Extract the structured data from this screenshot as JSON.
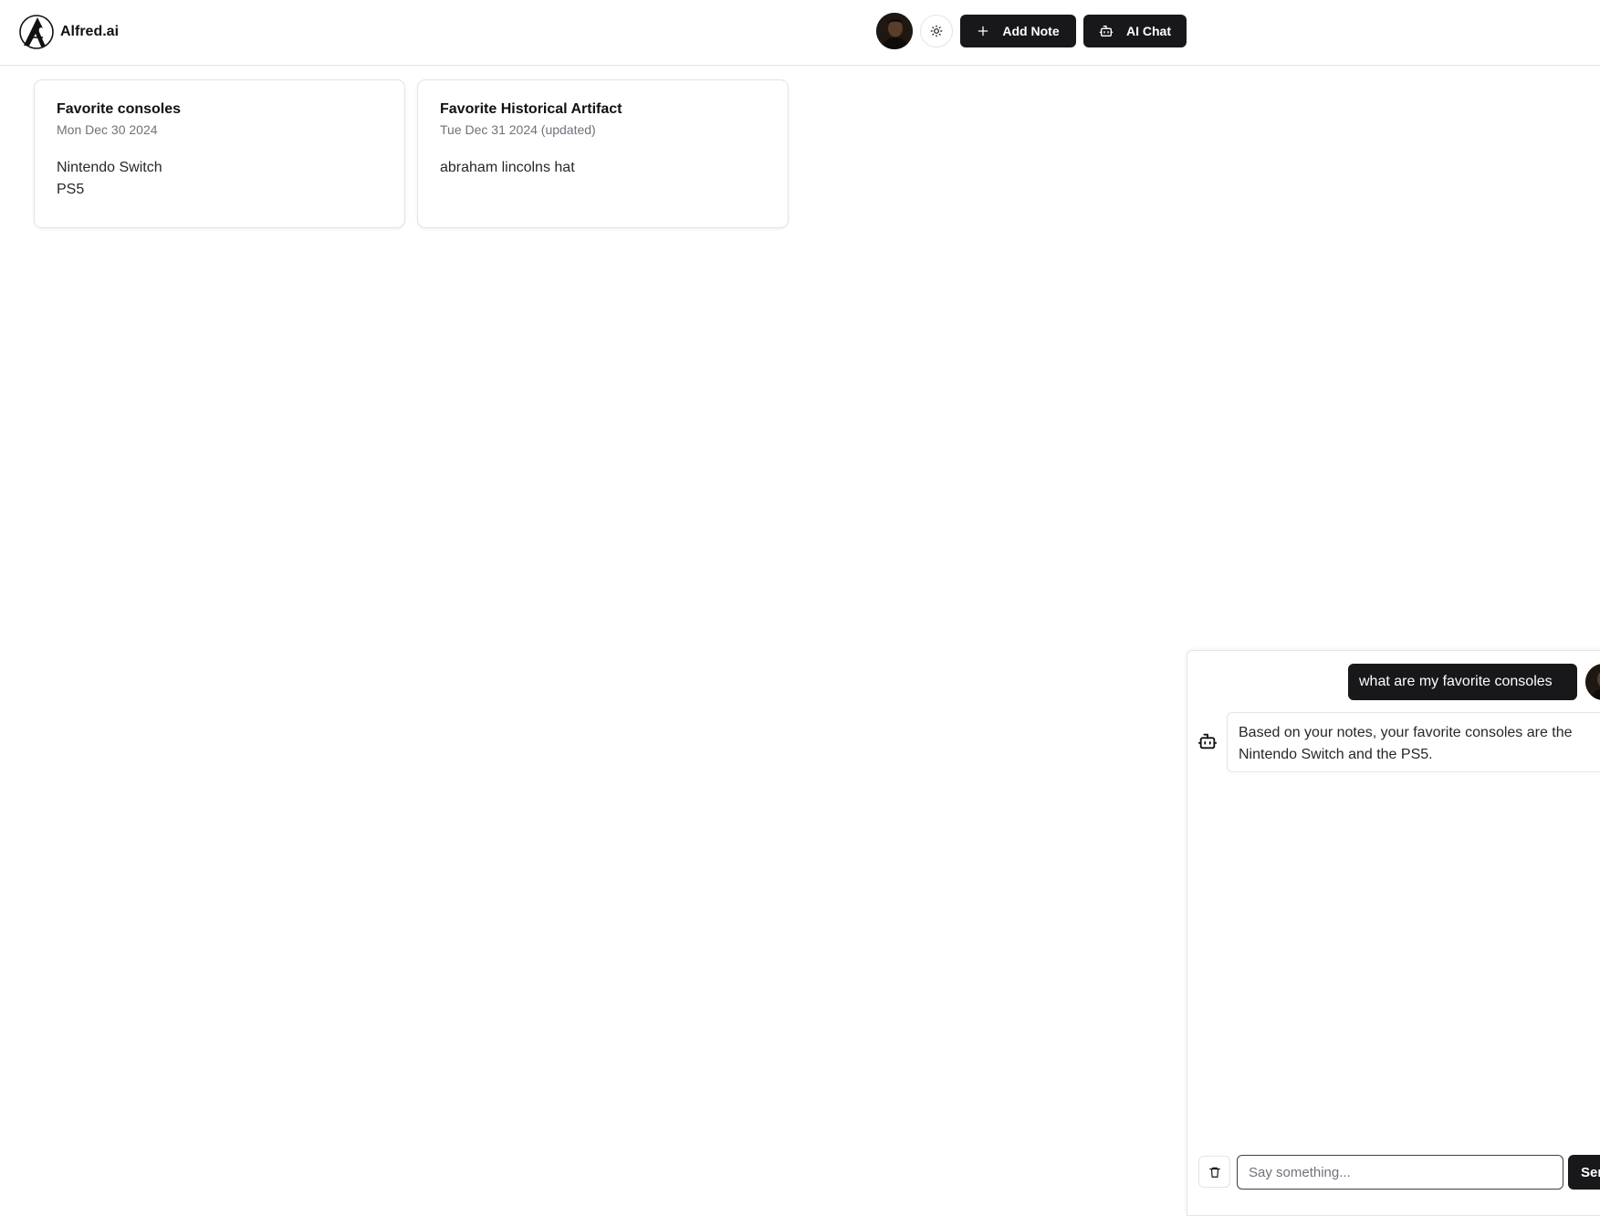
{
  "header": {
    "brand_name": "Alfred.ai",
    "logo_icon": "alfred-a-logo-icon",
    "theme_toggle_icon": "sun-icon",
    "add_note_label": "Add Note",
    "add_note_icon": "plus-icon",
    "ai_chat_label": "AI Chat",
    "ai_chat_icon": "bot-icon"
  },
  "notes": [
    {
      "title": "Favorite consoles",
      "date": "Mon Dec 30 2024",
      "body": "Nintendo Switch\nPS5"
    },
    {
      "title": "Favorite Historical Artifact",
      "date": "Tue Dec 31 2024 (updated)",
      "body": "abraham lincolns hat"
    }
  ],
  "chat": {
    "messages": [
      {
        "role": "user",
        "text": "what are my favorite consoles"
      },
      {
        "role": "assistant",
        "text": "Based on your notes, your favorite consoles are the Nintendo Switch and the PS5."
      }
    ],
    "input_placeholder": "Say something...",
    "input_value": "",
    "send_label": "Send",
    "clear_icon": "trash-icon"
  },
  "colors": {
    "primary": "#18181b",
    "border": "#e4e4e7",
    "muted_text": "#71717a",
    "background": "#ffffff"
  }
}
